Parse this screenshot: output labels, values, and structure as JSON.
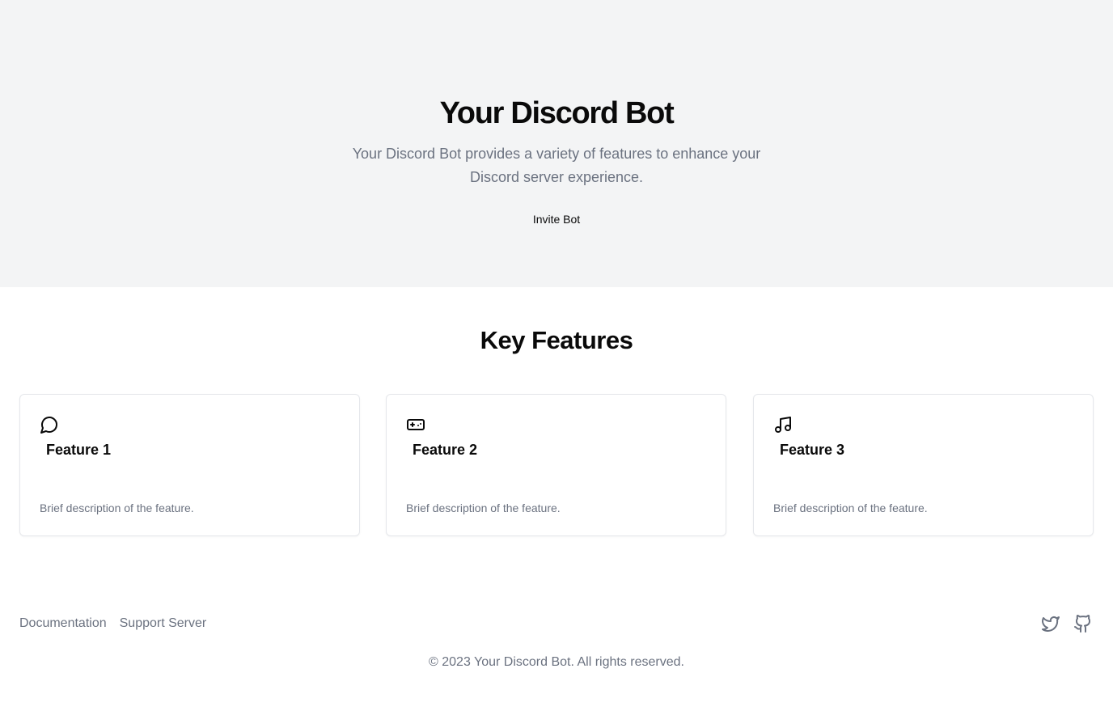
{
  "hero": {
    "title": "Your Discord Bot",
    "subtitle": "Your Discord Bot provides a variety of features to enhance your Discord server experience.",
    "button_label": "Invite Bot"
  },
  "features": {
    "heading": "Key Features",
    "cards": [
      {
        "icon": "message-circle-icon",
        "title": "Feature 1",
        "description": "Brief description of the feature."
      },
      {
        "icon": "gamepad-icon",
        "title": "Feature 2",
        "description": "Brief description of the feature."
      },
      {
        "icon": "music-icon",
        "title": "Feature 3",
        "description": "Brief description of the feature."
      }
    ]
  },
  "footer": {
    "links": [
      "Documentation",
      "Support Server"
    ],
    "social": [
      "twitter-icon",
      "github-icon"
    ],
    "copyright": "© 2023 Your Discord Bot. All rights reserved."
  },
  "colors": {
    "hero_bg": "#f3f4f5",
    "muted_text": "#6b7280",
    "card_border": "#e5e7eb",
    "heading_text": "#0a0a0a"
  }
}
